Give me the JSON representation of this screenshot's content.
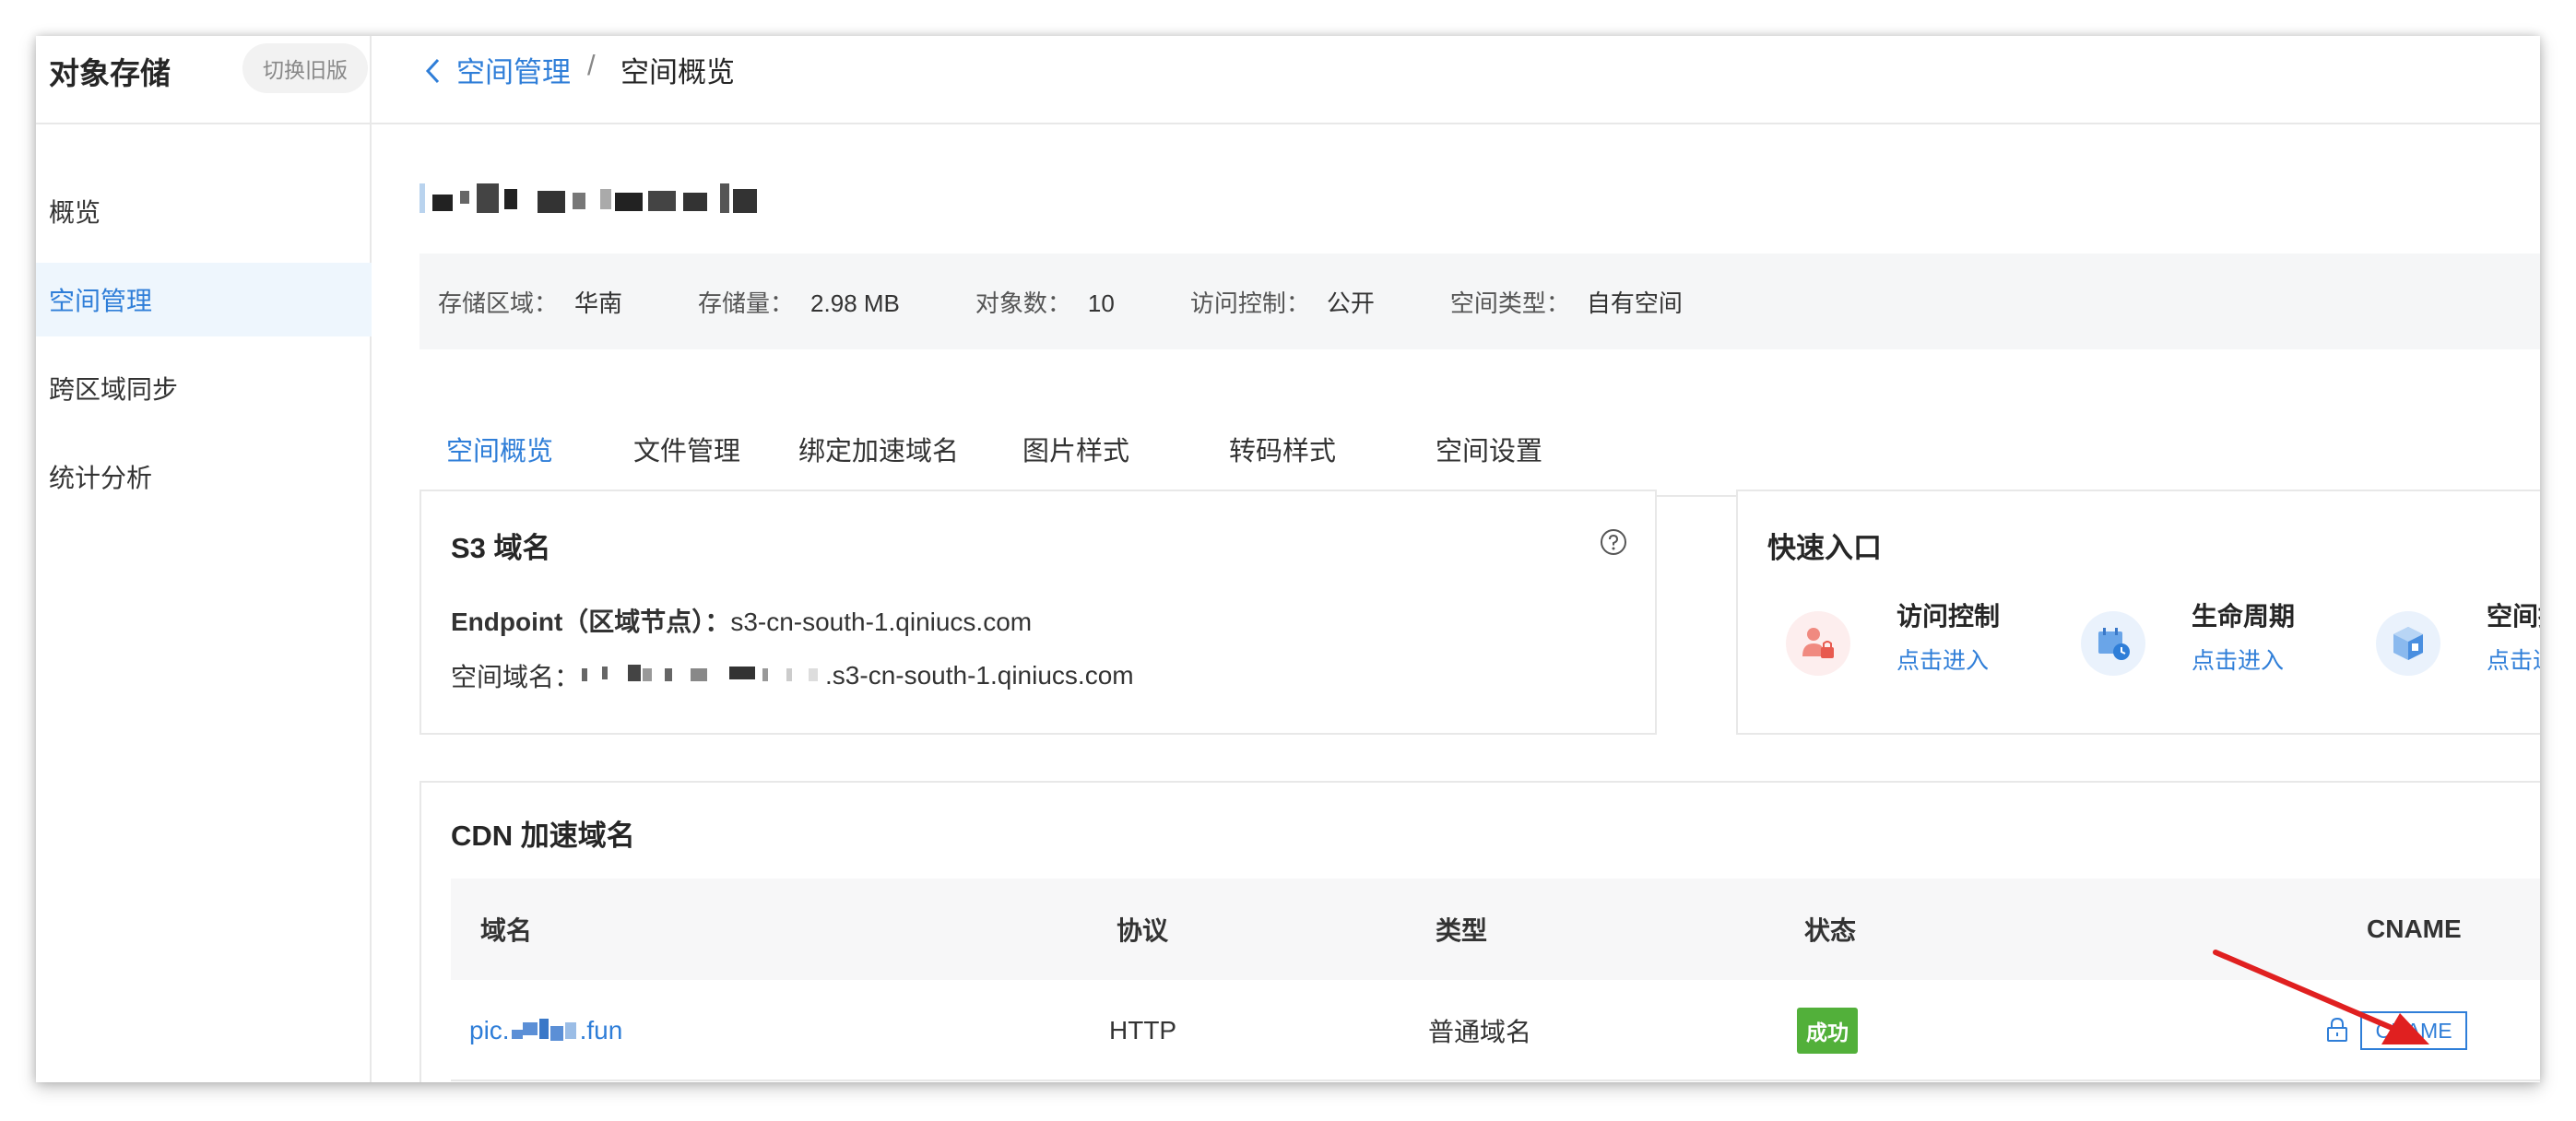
{
  "sidebar": {
    "title": "对象存储",
    "switch_label": "切换旧版",
    "items": [
      {
        "label": "概览",
        "active": false
      },
      {
        "label": "空间管理",
        "active": true
      },
      {
        "label": "跨区域同步",
        "active": false
      },
      {
        "label": "统计分析",
        "active": false
      }
    ]
  },
  "breadcrumb": {
    "parent": "空间管理",
    "separator": "/",
    "current": "空间概览"
  },
  "info": {
    "region_label": "存储区域：",
    "region_value": "华南",
    "storage_label": "存储量：",
    "storage_value": "2.98 MB",
    "objects_label": "对象数：",
    "objects_value": "10",
    "access_label": "访问控制：",
    "access_value": "公开",
    "type_label": "空间类型：",
    "type_value": "自有空间"
  },
  "tabs": [
    {
      "label": "空间概览",
      "active": true
    },
    {
      "label": "文件管理",
      "active": false
    },
    {
      "label": "绑定加速域名",
      "active": false
    },
    {
      "label": "图片样式",
      "active": false
    },
    {
      "label": "转码样式",
      "active": false
    },
    {
      "label": "空间设置",
      "active": false
    }
  ],
  "s3": {
    "title": "S3 域名",
    "endpoint_label": "Endpoint（区域节点）：",
    "endpoint_value": "s3-cn-south-1.qiniucs.com",
    "space_label": "空间域名：",
    "space_suffix": ".s3-cn-south-1.qiniucs.com"
  },
  "quick": {
    "title": "快速入口",
    "items": [
      {
        "label": "访问控制",
        "link": "点击进入"
      },
      {
        "label": "生命周期",
        "link": "点击进入"
      },
      {
        "label": "空间授",
        "link": "点击进入"
      }
    ]
  },
  "cdn": {
    "title": "CDN 加速域名",
    "columns": [
      "域名",
      "协议",
      "类型",
      "状态",
      "CNAME"
    ],
    "rows": [
      {
        "domain_prefix": "pic.",
        "domain_suffix": ".fun",
        "protocol": "HTTP",
        "type": "普通域名",
        "status": "成功",
        "cname_button": "CNAME"
      }
    ]
  },
  "colors": {
    "accent": "#2f7ed8",
    "success": "#52b03a",
    "annotation_arrow": "#e02020"
  }
}
